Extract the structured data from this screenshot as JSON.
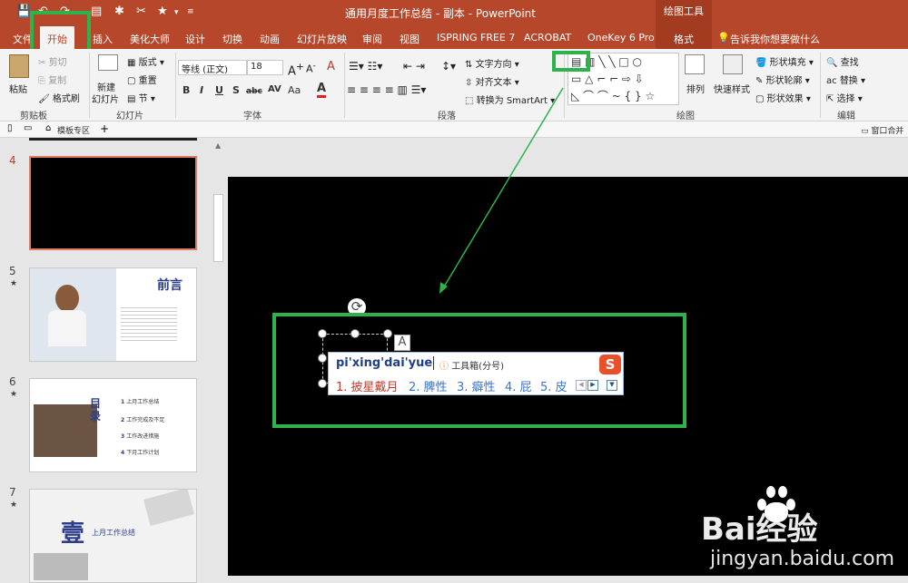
{
  "window": {
    "title": "通用月度工作总结 - 副本  -  PowerPoint",
    "context_tab_group": "绘图工具"
  },
  "tabs": [
    "文件",
    "开始",
    "插入",
    "美化大师",
    "设计",
    "切换",
    "动画",
    "幻灯片放映",
    "审阅",
    "视图",
    "ISPRING FREE 7",
    "ACROBAT",
    "OneKey 6 Pro",
    "格式"
  ],
  "tell_me": "告诉我你想要做什么",
  "ribbon": {
    "clipboard": {
      "label": "剪贴板",
      "paste": "粘贴",
      "cut": "剪切",
      "copy": "复制",
      "format_painter": "格式刷"
    },
    "slides": {
      "label": "幻灯片",
      "new_slide_1": "新建",
      "new_slide_2": "幻灯片",
      "layout": "版式",
      "reset": "重置",
      "section": "节"
    },
    "font": {
      "label": "字体",
      "font_name": "等线 (正文)",
      "font_size": "18",
      "bold": "B",
      "italic": "I",
      "underline": "U",
      "shadow": "S",
      "strike": "abc",
      "spacing": "AV",
      "case": "Aa",
      "color": "A"
    },
    "paragraph": {
      "label": "段落",
      "text_direction": "文字方向",
      "align_text": "对齐文本",
      "smartart": "转换为 SmartArt"
    },
    "drawing": {
      "label": "绘图",
      "arrange": "排列",
      "quick_styles": "快速样式",
      "shape_fill": "形状填充",
      "shape_outline": "形状轮廓",
      "shape_effects": "形状效果"
    },
    "editing": {
      "label": "编辑",
      "find": "查找",
      "replace": "替换",
      "select": "选择"
    }
  },
  "tabstrip": {
    "template_zone": "模板专区",
    "merge": "窗口合并显示"
  },
  "slides": [
    {
      "number": "4",
      "star": ""
    },
    {
      "number": "5",
      "star": "★",
      "heading": "前言"
    },
    {
      "number": "6",
      "star": "★",
      "heading": "目录",
      "items": [
        "上月工作总结",
        "工作完成及不足",
        "工作改进措施",
        "下月工作计划"
      ]
    },
    {
      "number": "7",
      "star": "★",
      "heading": "壹",
      "subtitle": "上月工作总结"
    }
  ],
  "ime": {
    "input": "pi'xing'dai'yue",
    "hint": "工具箱(分号)",
    "candidates": [
      "1. 披星戴月",
      "2. 脾性",
      "3. 癖性",
      "4. 屁",
      "5. 皮"
    ]
  },
  "watermark": {
    "brand": "Bai经验",
    "url": "jingyan.baidu.com"
  },
  "colors": {
    "accent": "#b7472a",
    "highlight_green": "#2db34a",
    "ime_blue": "#3b73c6",
    "ime_red": "#c0392b"
  }
}
